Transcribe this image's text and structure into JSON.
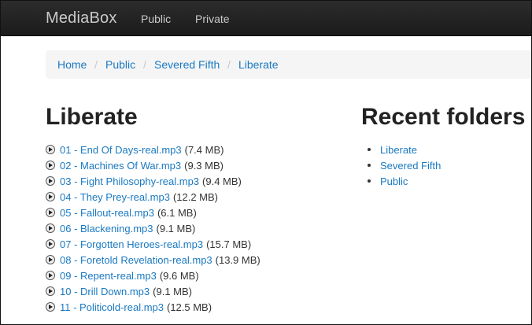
{
  "navbar": {
    "brand": "MediaBox",
    "links": [
      "Public",
      "Private"
    ]
  },
  "breadcrumb": {
    "items": [
      "Home",
      "Public",
      "Severed Fifth",
      "Liberate"
    ],
    "separator": "/"
  },
  "main": {
    "title": "Liberate",
    "files": [
      {
        "name": "01 - End Of Days-real.mp3",
        "size": "(7.4 MB)"
      },
      {
        "name": "02 - Machines Of War.mp3",
        "size": "(9.3 MB)"
      },
      {
        "name": "03 - Fight Philosophy-real.mp3",
        "size": "(9.4 MB)"
      },
      {
        "name": "04 - They Prey-real.mp3",
        "size": "(12.2 MB)"
      },
      {
        "name": "05 - Fallout-real.mp3",
        "size": "(6.1 MB)"
      },
      {
        "name": "06 - Blackening.mp3",
        "size": "(9.1 MB)"
      },
      {
        "name": "07 - Forgotten Heroes-real.mp3",
        "size": "(15.7 MB)"
      },
      {
        "name": "08 - Foretold Revelation-real.mp3",
        "size": "(13.9 MB)"
      },
      {
        "name": "09 - Repent-real.mp3",
        "size": "(9.6 MB)"
      },
      {
        "name": "10 - Drill Down.mp3",
        "size": "(9.1 MB)"
      },
      {
        "name": "11 - Politicold-real.mp3",
        "size": "(12.5 MB)"
      }
    ]
  },
  "sidebar": {
    "title": "Recent folders",
    "items": [
      "Liberate",
      "Severed Fifth",
      "Public"
    ]
  },
  "colors": {
    "link": "#1a79c2",
    "navbar": "#1f1f1f",
    "breadcrumb_bg": "#f5f5f5"
  },
  "icons": {
    "file": "play-icon"
  }
}
